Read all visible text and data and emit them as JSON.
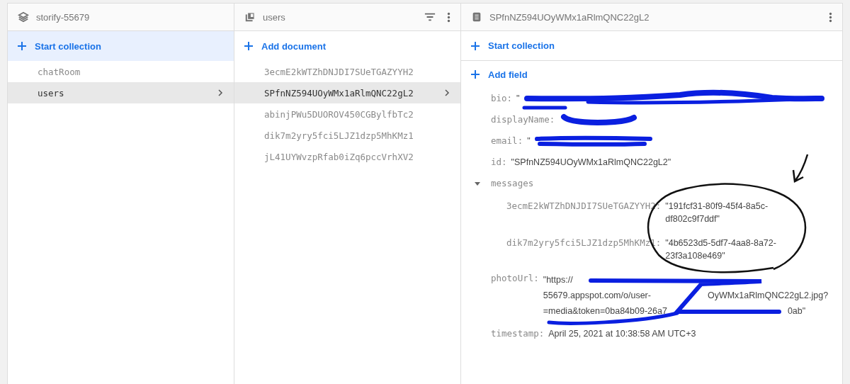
{
  "header": {
    "project": "storify-55679",
    "collection": "users",
    "document": "SPfnNZ594UOyWMx1aRlmQNC22gL2"
  },
  "collections_panel": {
    "action": "Start collection",
    "items": [
      {
        "label": "chatRoom",
        "selected": false
      },
      {
        "label": "users",
        "selected": true
      }
    ]
  },
  "documents_panel": {
    "action": "Add document",
    "items": [
      {
        "label": "3ecmE2kWTZhDNJDI7SUeTGAZYYH2",
        "selected": false
      },
      {
        "label": "SPfnNZ594UOyWMx1aRlmQNC22gL2",
        "selected": true
      },
      {
        "label": "abinjPWu5DUOROV450CGBylfbTc2",
        "selected": false
      },
      {
        "label": "dik7m2yry5fci5LJZ1dzp5MhKMz1",
        "selected": false
      },
      {
        "label": "jL41UYWvzpRfab0iZq6pccVrhXV2",
        "selected": false
      }
    ]
  },
  "document_panel": {
    "collection_action": "Start collection",
    "field_action": "Add field",
    "fields": [
      {
        "kind": "plain",
        "key": "bio:",
        "lines": [
          [
            "\""
          ]
        ]
      },
      {
        "kind": "plain",
        "key": "displayName:"
      },
      {
        "kind": "plain",
        "key": "email:",
        "lines": [
          [
            "\""
          ]
        ]
      },
      {
        "kind": "plain",
        "key": "id:",
        "lines": [
          [
            "\"SPfnNZ594UOyWMx1aRlmQNC22gL2\""
          ]
        ]
      },
      {
        "kind": "map",
        "key": "messages",
        "expanded": true,
        "children": [
          {
            "key": "3ecmE2kWTZhDNJDI7SUeTGAZYYH2:",
            "lines": [
              [
                "\"191fcf31-80f9-45f4-8a5c-"
              ],
              [
                "df802c9f7ddf\""
              ]
            ]
          },
          {
            "key": "dik7m2yry5fci5LJZ1dzp5MhKMz1:",
            "lines": [
              [
                "\"4b6523d5-5df7-4aa8-8a72-"
              ],
              [
                "23f3a108e469\""
              ]
            ]
          }
        ]
      },
      {
        "kind": "plain",
        "key": "photoUrl:",
        "lines": [
          [
            "\"https://"
          ],
          [
            "55679.appspot.com/o/user-",
            "OyWMx1aRlmQNC22gL2.jpg?"
          ],
          [
            "=media&token=0ba84b09-26a7",
            "0ab\""
          ]
        ]
      },
      {
        "kind": "plain",
        "key": "timestamp:",
        "lines": [
          [
            "April 25, 2021 at 10:38:58 AM UTC+3"
          ]
        ]
      }
    ]
  }
}
